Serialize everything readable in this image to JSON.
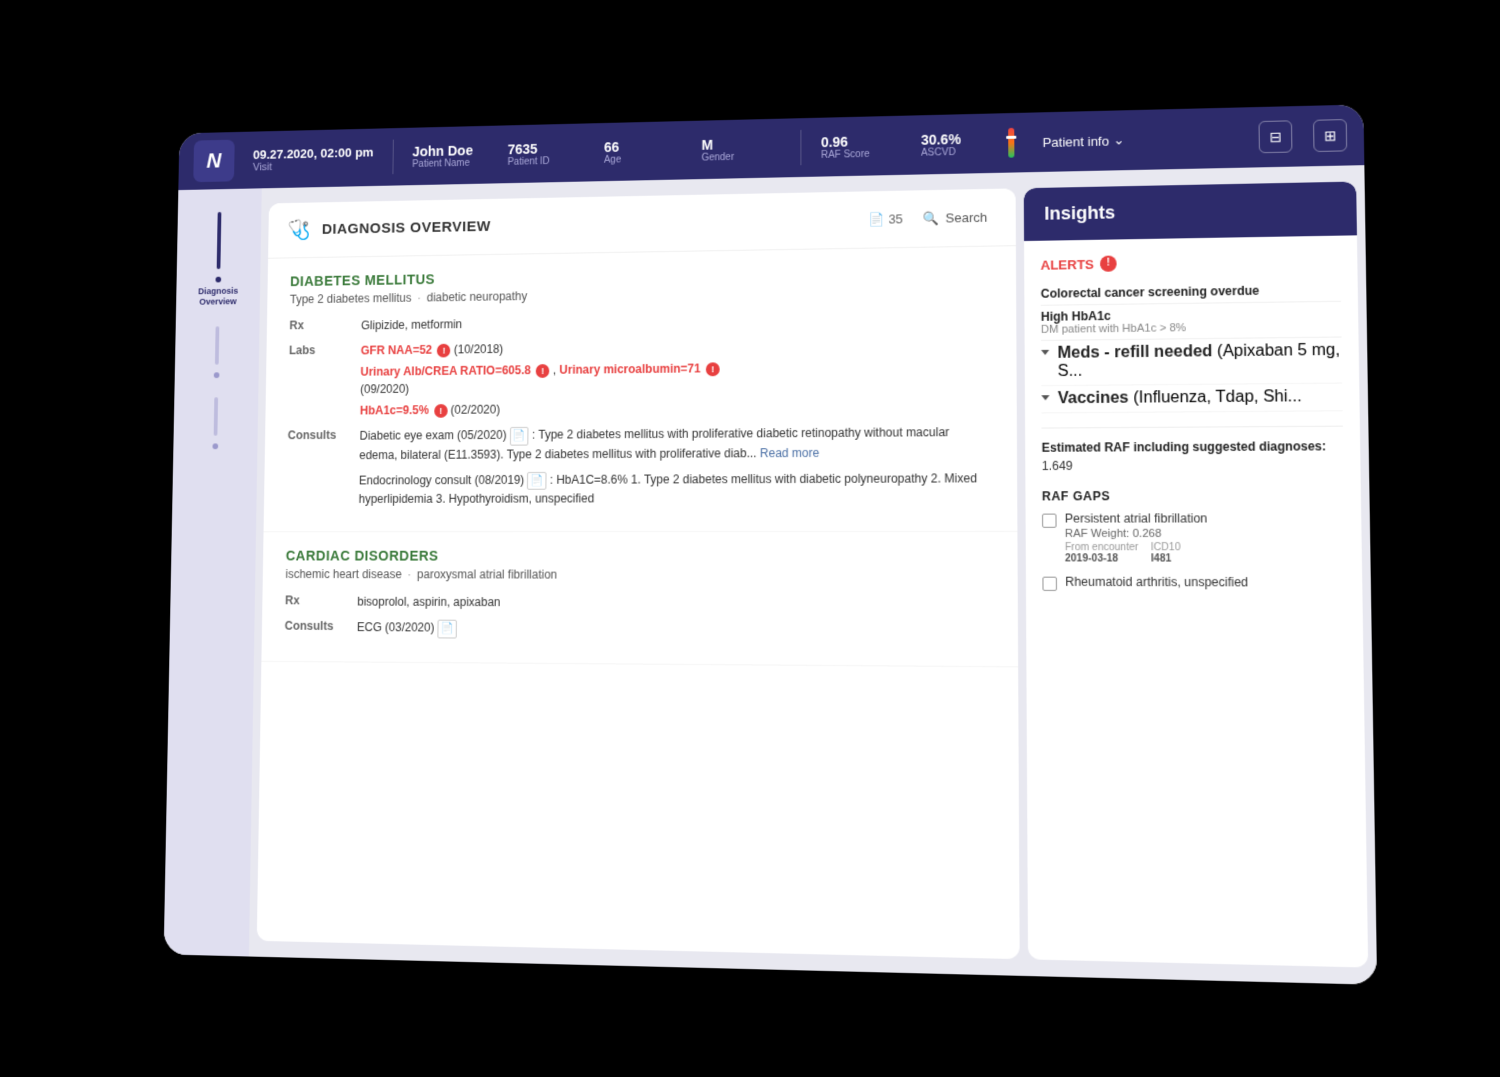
{
  "app": {
    "logo": "N"
  },
  "nav": {
    "date": "09.27.2020, 02:00 pm",
    "visit_label": "Visit",
    "patient_name": "John Doe",
    "patient_name_label": "Patient Name",
    "patient_id": "7635",
    "patient_id_label": "Patient ID",
    "age": "66",
    "age_label": "Age",
    "gender": "M",
    "gender_label": "Gender",
    "raf_score": "0.96",
    "raf_score_label": "RAF Score",
    "ascvd": "30.6%",
    "ascvd_label": "ASCVD",
    "patient_info_btn": "Patient info",
    "icon1": "☰",
    "icon2": "⊞"
  },
  "sidebar": {
    "items": [
      {
        "label": "Diagnosis Overview",
        "active": true
      }
    ]
  },
  "center": {
    "title": "DIAGNOSIS OVERVIEW",
    "docs_count": "35",
    "search_label": "Search",
    "sections": [
      {
        "id": "diabetes",
        "title": "DIABETES MELLITUS",
        "subtitle1": "Type 2 diabetes mellitus",
        "subtitle2": "diabetic neuropathy",
        "rx": "Glipizide, metformin",
        "labs": [
          {
            "text": "GFR NAA=52",
            "alert": true,
            "date": "(10/2018)"
          },
          {
            "text": "Urinary Alb/CREA RATIO=605.8",
            "alert": true,
            "extra": ", Urinary microalbumin=71",
            "extra_alert": true,
            "date": "(09/2020)"
          },
          {
            "text": "HbA1c=9.5%",
            "alert": true,
            "date": "(02/2020)"
          }
        ],
        "consults": [
          {
            "text": "Diabetic eye exam (05/2020)",
            "has_doc": true,
            "detail": ": Type 2 diabetes mellitus with proliferative diabetic retinopathy without macular edema, bilateral (E11.3593). Type 2 diabetes mellitus with proliferative diab...",
            "read_more": "Read more"
          },
          {
            "text": "Endocrinology consult (08/2019)",
            "has_doc": true,
            "detail": ": HbA1C=8.6% 1. Type 2 diabetes mellitus with diabetic polyneuropathy 2. Mixed hyperlipidemia 3. Hypothyroidism, unspecified",
            "read_more": null
          }
        ]
      },
      {
        "id": "cardiac",
        "title": "CARDIAC DISORDERS",
        "subtitle1": "ischemic heart disease",
        "subtitle2": "paroxysmal atrial fibrillation",
        "rx": "bisoprolol, aspirin, apixaban",
        "consults": [
          {
            "text": "ECG (03/2020)",
            "has_doc": true,
            "detail": "",
            "read_more": null
          }
        ]
      }
    ]
  },
  "insights": {
    "title": "Insights",
    "alerts_title": "ALERTS",
    "alert_icon": "!",
    "alerts": [
      {
        "main": "Colorectal cancer screening overdue",
        "sub": null
      },
      {
        "main": "High HbA1c",
        "sub": "DM patient with HbA1c > 8%"
      },
      {
        "main": "Meds - refill needed",
        "detail": "(Apixaban 5 mg, S...",
        "has_chevron": true
      },
      {
        "main": "Vaccines",
        "detail": "(Influenza, Tdap, Shi...",
        "has_chevron": true
      }
    ],
    "raf_estimated_label": "Estimated RAF including suggested diagnoses:",
    "raf_estimated_value": "1.649",
    "raf_gaps_title": "RAF GAPS",
    "raf_gaps": [
      {
        "name": "Persistent atrial fibrillation",
        "weight_label": "RAF Weight:",
        "weight_value": "0.268",
        "meta": [
          {
            "label": "From encounter",
            "value": "2019-03-18"
          },
          {
            "label": "ICD10",
            "value": "I481"
          }
        ]
      },
      {
        "name": "Rheumatoid arthritis, unspecified",
        "weight_label": null,
        "weight_value": null,
        "meta": []
      }
    ]
  }
}
